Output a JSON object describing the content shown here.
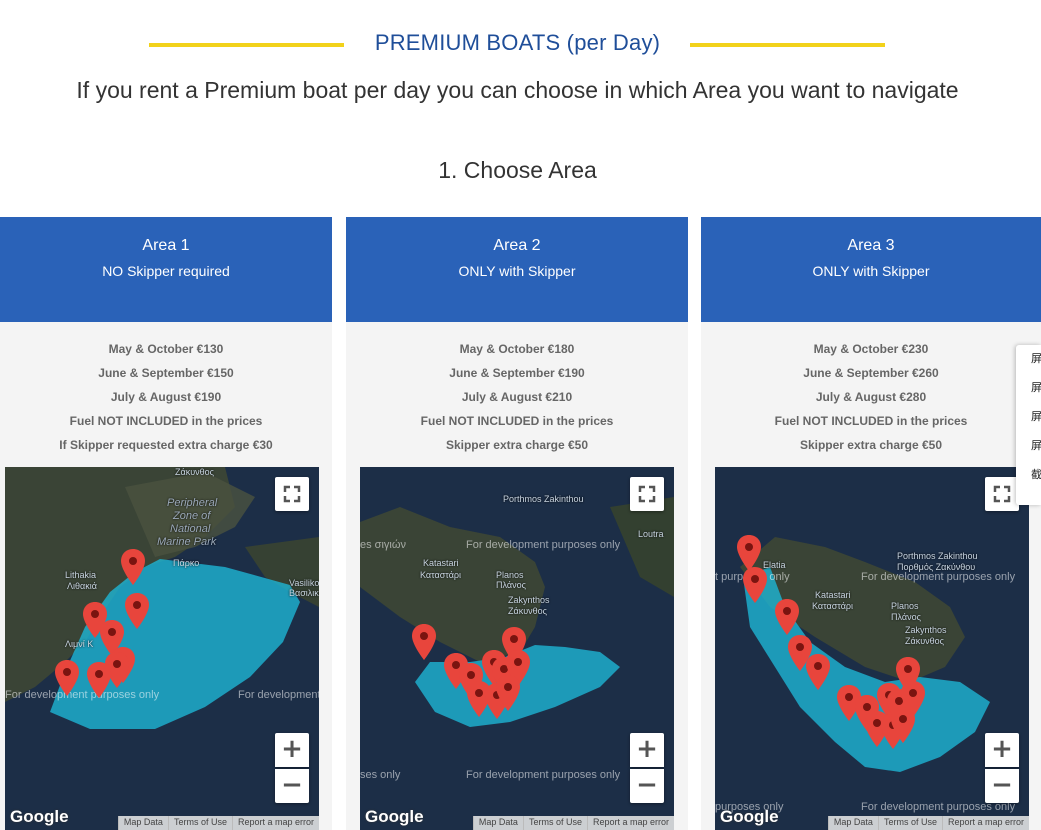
{
  "header": {
    "title": "PREMIUM BOATS (per Day)",
    "subtitle": "If you rent a Premium boat per day you can choose in which Area you want to navigate",
    "step": "1. Choose Area"
  },
  "colors": {
    "accent_line": "#f2d21a",
    "card_header": "#2a62b8",
    "title": "#1f4e99",
    "polygon": "#1eb8d8",
    "marker": "#e8453c"
  },
  "areas": [
    {
      "name": "Area 1",
      "note": "NO Skipper required",
      "prices": [
        "May & October €130",
        "June & September €150",
        "July & August €190",
        "Fuel NOT INCLUDED in the prices",
        "If Skipper requested extra charge €30"
      ],
      "map_labels": [
        "Zone of",
        "National",
        "Marine Park",
        "Peripheral",
        "Lithakia",
        "Λιθακιά",
        "Vasilikos",
        "Βασιλικός",
        "Ζάκυνθος",
        "Λιμνί Κ",
        "Πάρκο"
      ],
      "dev_text": [
        "For development purposes only",
        "For development purposes only"
      ]
    },
    {
      "name": "Area 2",
      "note": "ONLY with Skipper",
      "prices": [
        "May & October €180",
        "June & September €190",
        "July & August €210",
        "Fuel NOT INCLUDED in the prices",
        "Skipper extra charge €50"
      ],
      "map_labels": [
        "Porthmos Zakinthou",
        "Katastari",
        "Καταστάρι",
        "Planos",
        "Πλάνος",
        "Zakynthos",
        "Ζάκυνθος",
        "Loutra"
      ],
      "dev_text": [
        "For development purposes only",
        "For development purposes only",
        "ses only",
        "es σιγιών"
      ]
    },
    {
      "name": "Area 3",
      "note": "ONLY with Skipper",
      "prices": [
        "May & October €230",
        "June & September €260",
        "July & August €280",
        "Fuel NOT INCLUDED in the prices",
        "Skipper extra charge €50"
      ],
      "map_labels": [
        "Porthmos Zakinthou",
        "Πορθμός Ζακύνθου",
        "Elatia",
        "Katastari",
        "Καταστάρι",
        "Planos",
        "Πλάνος",
        "Zakynthos",
        "Ζάκυνθος"
      ],
      "dev_text": [
        "For development purposes only",
        "For development purposes only",
        "t purposes only",
        "purposes only"
      ]
    }
  ],
  "map_controls": {
    "zoom_in": "+",
    "zoom_out": "−",
    "logo": "Google",
    "footer": [
      "Map Data",
      "Terms of Use",
      "Report a map error"
    ]
  },
  "side_panel": [
    "屏",
    "屏",
    "屏",
    "屏",
    "截"
  ]
}
